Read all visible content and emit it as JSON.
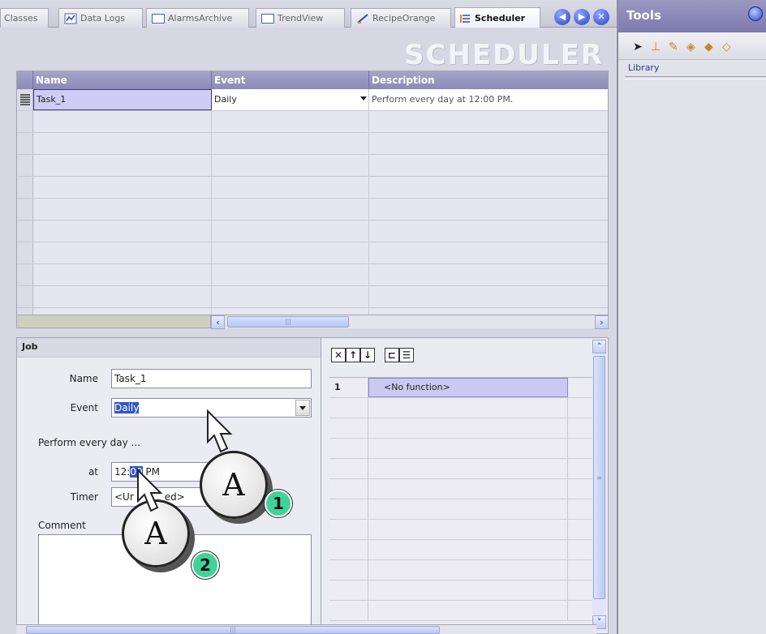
{
  "tabs": [
    {
      "label": "Classes",
      "icon": "classes-icon"
    },
    {
      "label": "Data Logs",
      "icon": "data-logs-icon"
    },
    {
      "label": "AlarmsArchive",
      "icon": "window-icon"
    },
    {
      "label": "TrendView",
      "icon": "window-icon"
    },
    {
      "label": "RecipeOrange",
      "icon": "recipe-icon"
    },
    {
      "label": "Scheduler",
      "icon": "scheduler-icon",
      "active": true
    }
  ],
  "nav": {
    "prev": "◀",
    "next": "▶",
    "close": "✕"
  },
  "scheduler": {
    "title": "SCHEDULER",
    "columns": [
      "Name",
      "Event",
      "Description"
    ],
    "rows": [
      {
        "name": "Task_1",
        "event": "Daily",
        "description": "Perform every day at 12:00 PM."
      }
    ]
  },
  "job": {
    "header": "Job",
    "name_label": "Name",
    "name_value": "Task_1",
    "event_label": "Event",
    "event_value": "Daily",
    "perform_label": "Perform every day ...",
    "at_label": "at",
    "at_value_prefix": "12:",
    "at_value_selected": "00",
    "at_value_suffix": " PM",
    "timer_label": "Timer",
    "timer_value": "<Undefined>",
    "timer_value_visible": "<Ur",
    "timer_value_visible_tail": "ed>",
    "comment_label": "Comment"
  },
  "functions": {
    "row_number": "1",
    "row_value": "<No function>"
  },
  "tools": {
    "title": "Tools",
    "library_label": "Library"
  },
  "callouts": [
    {
      "letters": "A",
      "number": "1"
    },
    {
      "letters": "A",
      "number": "2"
    }
  ],
  "colors": {
    "accent": "#8c89b6",
    "selection": "#cfcdf5",
    "highlight": "#2f55c8",
    "badge": "#3fd39a"
  }
}
